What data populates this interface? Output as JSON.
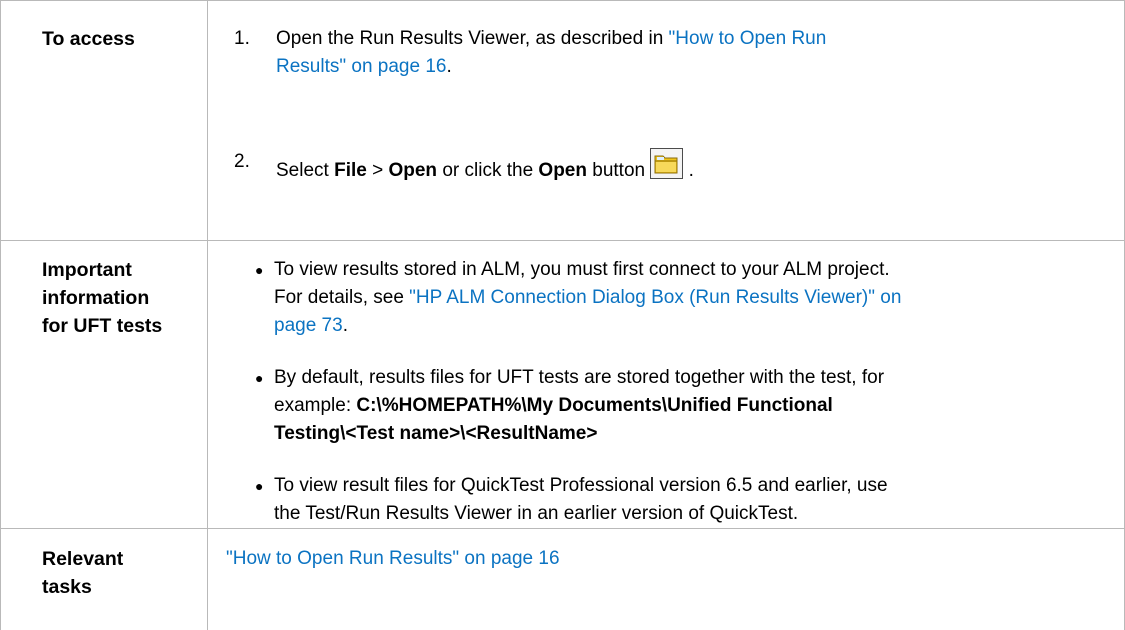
{
  "rows": [
    {
      "label_lines": [
        "To access"
      ],
      "steps": [
        {
          "num": "1.",
          "text_before": "Open the Run Results Viewer, as described in ",
          "link_line1": "\"How to Open Run",
          "link_line2": "Results\" on page 16",
          "text_after": "."
        },
        {
          "num": "2.",
          "t1": "Select ",
          "b1": "File",
          "t2": " > ",
          "b2": "Open",
          "t3": " or click the ",
          "b3": "Open",
          "t4": " button",
          "t5": " ."
        }
      ]
    },
    {
      "label_lines": [
        "Important",
        "information",
        "for UFT tests"
      ],
      "bullets": [
        {
          "line1": "To view results stored in ALM, you must first connect to your ALM project.",
          "line2_text": "For details, see ",
          "link_line2": "\"HP ALM Connection Dialog Box (Run Results Viewer)\" on",
          "link_line3": "page 73",
          "text_after": "."
        },
        {
          "line1": "By default, results files for UFT tests are stored together with the test, for",
          "line2_text": "example: ",
          "bold_line2": "C:\\%HOMEPATH%\\My Documents\\Unified Functional",
          "bold_line3": "Testing\\<Test name>\\<ResultName>"
        },
        {
          "line1": "To view result files for QuickTest Professional version 6.5 and earlier, use",
          "line2": "the Test/Run Results Viewer in an earlier version of QuickTest."
        }
      ]
    },
    {
      "label_lines": [
        "Relevant",
        "tasks"
      ],
      "link": "\"How to Open Run Results\" on page 16"
    }
  ],
  "colors": {
    "link": "#0b73c2",
    "border": "#b9b9b9"
  },
  "icons": [
    "bullet-icon",
    "folder-open-icon"
  ]
}
